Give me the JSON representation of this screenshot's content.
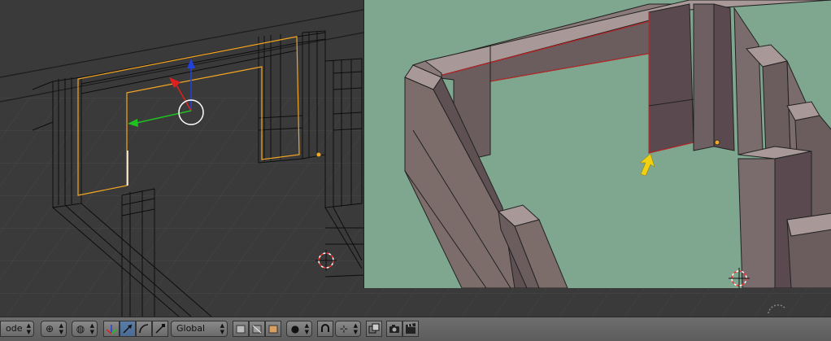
{
  "header": {
    "mode_label": "ode",
    "orientation_label": "Global"
  },
  "icons": [
    "globe-icon",
    "shading-icon",
    "manipulator-icon",
    "translate-icon",
    "rotate-icon",
    "scale-icon",
    "vertex-select-icon",
    "edge-select-icon",
    "face-select-icon",
    "pivot-icon",
    "snap-magnet-icon",
    "snap-target-icon",
    "copy-icon",
    "render-icon",
    "animation-render-icon"
  ],
  "colors": {
    "selection": "#f5a623",
    "axis_x": "#e02020",
    "axis_y": "#20c020",
    "axis_z": "#2040e0",
    "pointer": "#f0d010",
    "solid_background": "#7fa78f"
  }
}
